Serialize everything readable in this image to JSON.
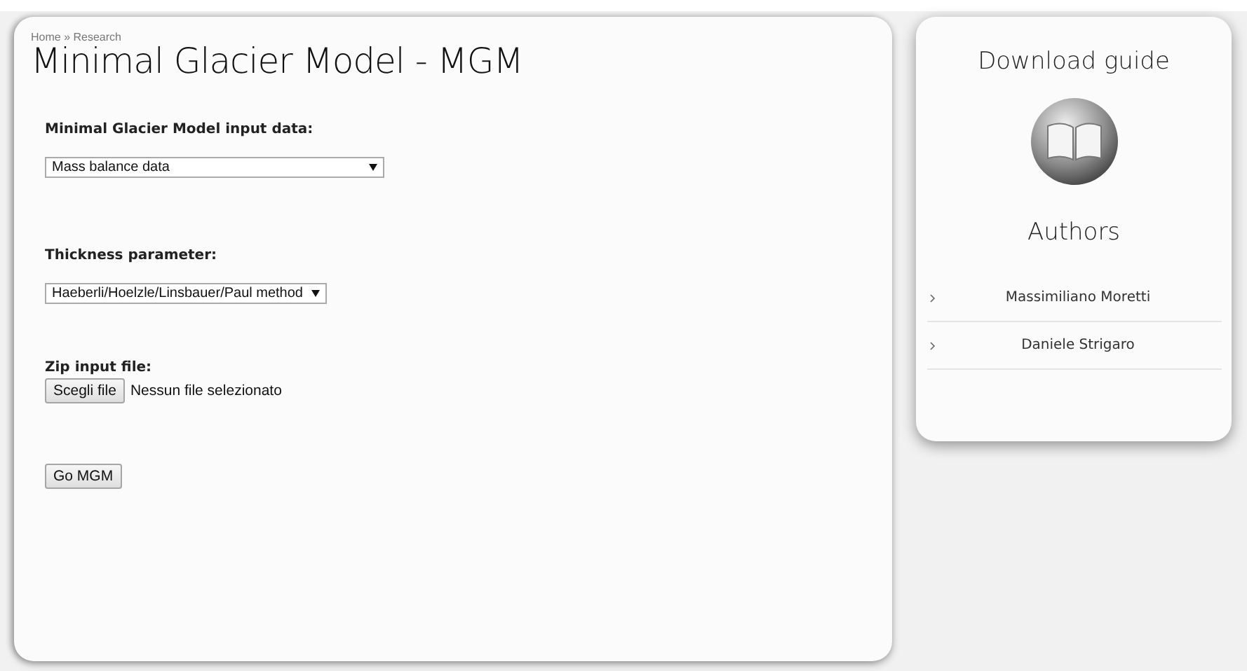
{
  "breadcrumb": "Home » Research",
  "page_title": "Minimal Glacier Model - MGM",
  "form": [
    {
      "kind": "select",
      "label": "Minimal Glacier Model input data:",
      "value": "Mass balance data"
    },
    {
      "kind": "select",
      "label": "Thickness parameter:",
      "value": "Haeberli/Hoelzle/Linsbauer/Paul method"
    },
    {
      "kind": "file",
      "label": "Zip input file:",
      "button": "Scegli file",
      "status": "Nessun file selezionato"
    }
  ],
  "submit": "Go MGM",
  "sidebar": {
    "download_title": "Download guide",
    "authors_title": "Authors",
    "authors": [
      {
        "name": "Massimiliano Moretti"
      },
      {
        "name": "Daniele Strigaro"
      }
    ]
  }
}
